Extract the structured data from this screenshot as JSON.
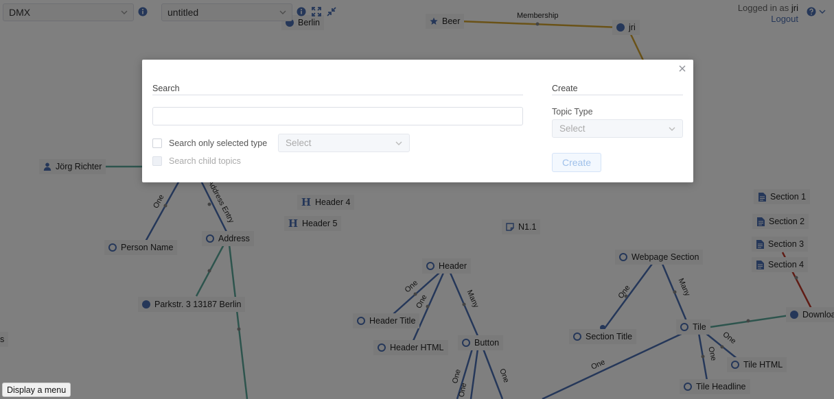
{
  "topbar": {
    "workspace": "DMX",
    "topicmap": "untitled",
    "logged_in_text": "Logged in as",
    "user": "jri",
    "logout_label": "Logout"
  },
  "graph": {
    "nodes": {
      "berlin": "Berlin",
      "beer": "Beer",
      "jri": "jri",
      "joerg": "Jörg Richter",
      "header4": "Header 4",
      "header5": "Header 5",
      "n11": "N1.1",
      "person_name": "Person Name",
      "address": "Address",
      "parkstr": "Parkstr. 3 13187 Berlin",
      "header": "Header",
      "header_title": "Header Title",
      "header_html": "Header HTML",
      "button": "Button",
      "webpage_section": "Webpage Section",
      "section_title": "Section Title",
      "tile": "Tile",
      "tile_html": "Tile HTML",
      "tile_headline": "Tile Headline",
      "section1": "Section 1",
      "section2": "Section 2",
      "section3": "Section 3",
      "section4": "Section 4",
      "download": "Download",
      "edge_s": "s"
    },
    "edge_labels": {
      "membership": "Membership",
      "one_a": "One",
      "address_entry": "Address Entry",
      "one_b": "One",
      "one_c": "One",
      "many_a": "Many",
      "one_d": "One",
      "many_b": "Many",
      "one_e": "One",
      "one_f": "One",
      "one_g": "One",
      "one_h": "One",
      "one_i": "One",
      "one_j": "One"
    }
  },
  "dialog": {
    "search_title": "Search",
    "search_value": "",
    "search_only_label": "Search only selected type",
    "type_select_placeholder": "Select",
    "child_topics_label": "Search child topics",
    "create_title": "Create",
    "topic_type_label": "Topic Type",
    "topic_type_placeholder": "Select",
    "create_label": "Create"
  },
  "menu_button_label": "Display a menu",
  "colors": {
    "accent": "#4a6fb3",
    "teal_edge": "#5aa99b",
    "gold_edge": "#d4a52e",
    "red_edge": "#c0392b"
  }
}
